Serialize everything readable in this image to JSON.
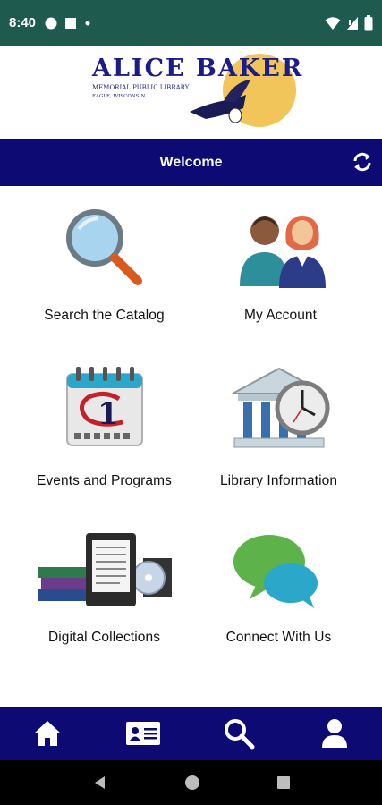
{
  "status_bar": {
    "time": "8:40"
  },
  "logo": {
    "title": "ALICE BAKER",
    "subtitle": "MEMORIAL PUBLIC LIBRARY",
    "location": "EAGLE, WISCONSIN"
  },
  "header": {
    "title": "Welcome"
  },
  "tiles": [
    {
      "label": "Search the Catalog",
      "icon": "magnifier-icon"
    },
    {
      "label": "My Account",
      "icon": "people-icon"
    },
    {
      "label": "Events and Programs",
      "icon": "calendar-icon"
    },
    {
      "label": "Library Information",
      "icon": "library-clock-icon"
    },
    {
      "label": "Digital Collections",
      "icon": "books-ereader-icon"
    },
    {
      "label": "Connect With Us",
      "icon": "chat-bubbles-icon"
    }
  ],
  "bottom_nav": [
    "home-icon",
    "id-card-icon",
    "search-icon",
    "user-icon"
  ],
  "colors": {
    "status_bar": "#1f5a4e",
    "brand_navy": "#0d0a73",
    "sun": "#f2c55a"
  }
}
